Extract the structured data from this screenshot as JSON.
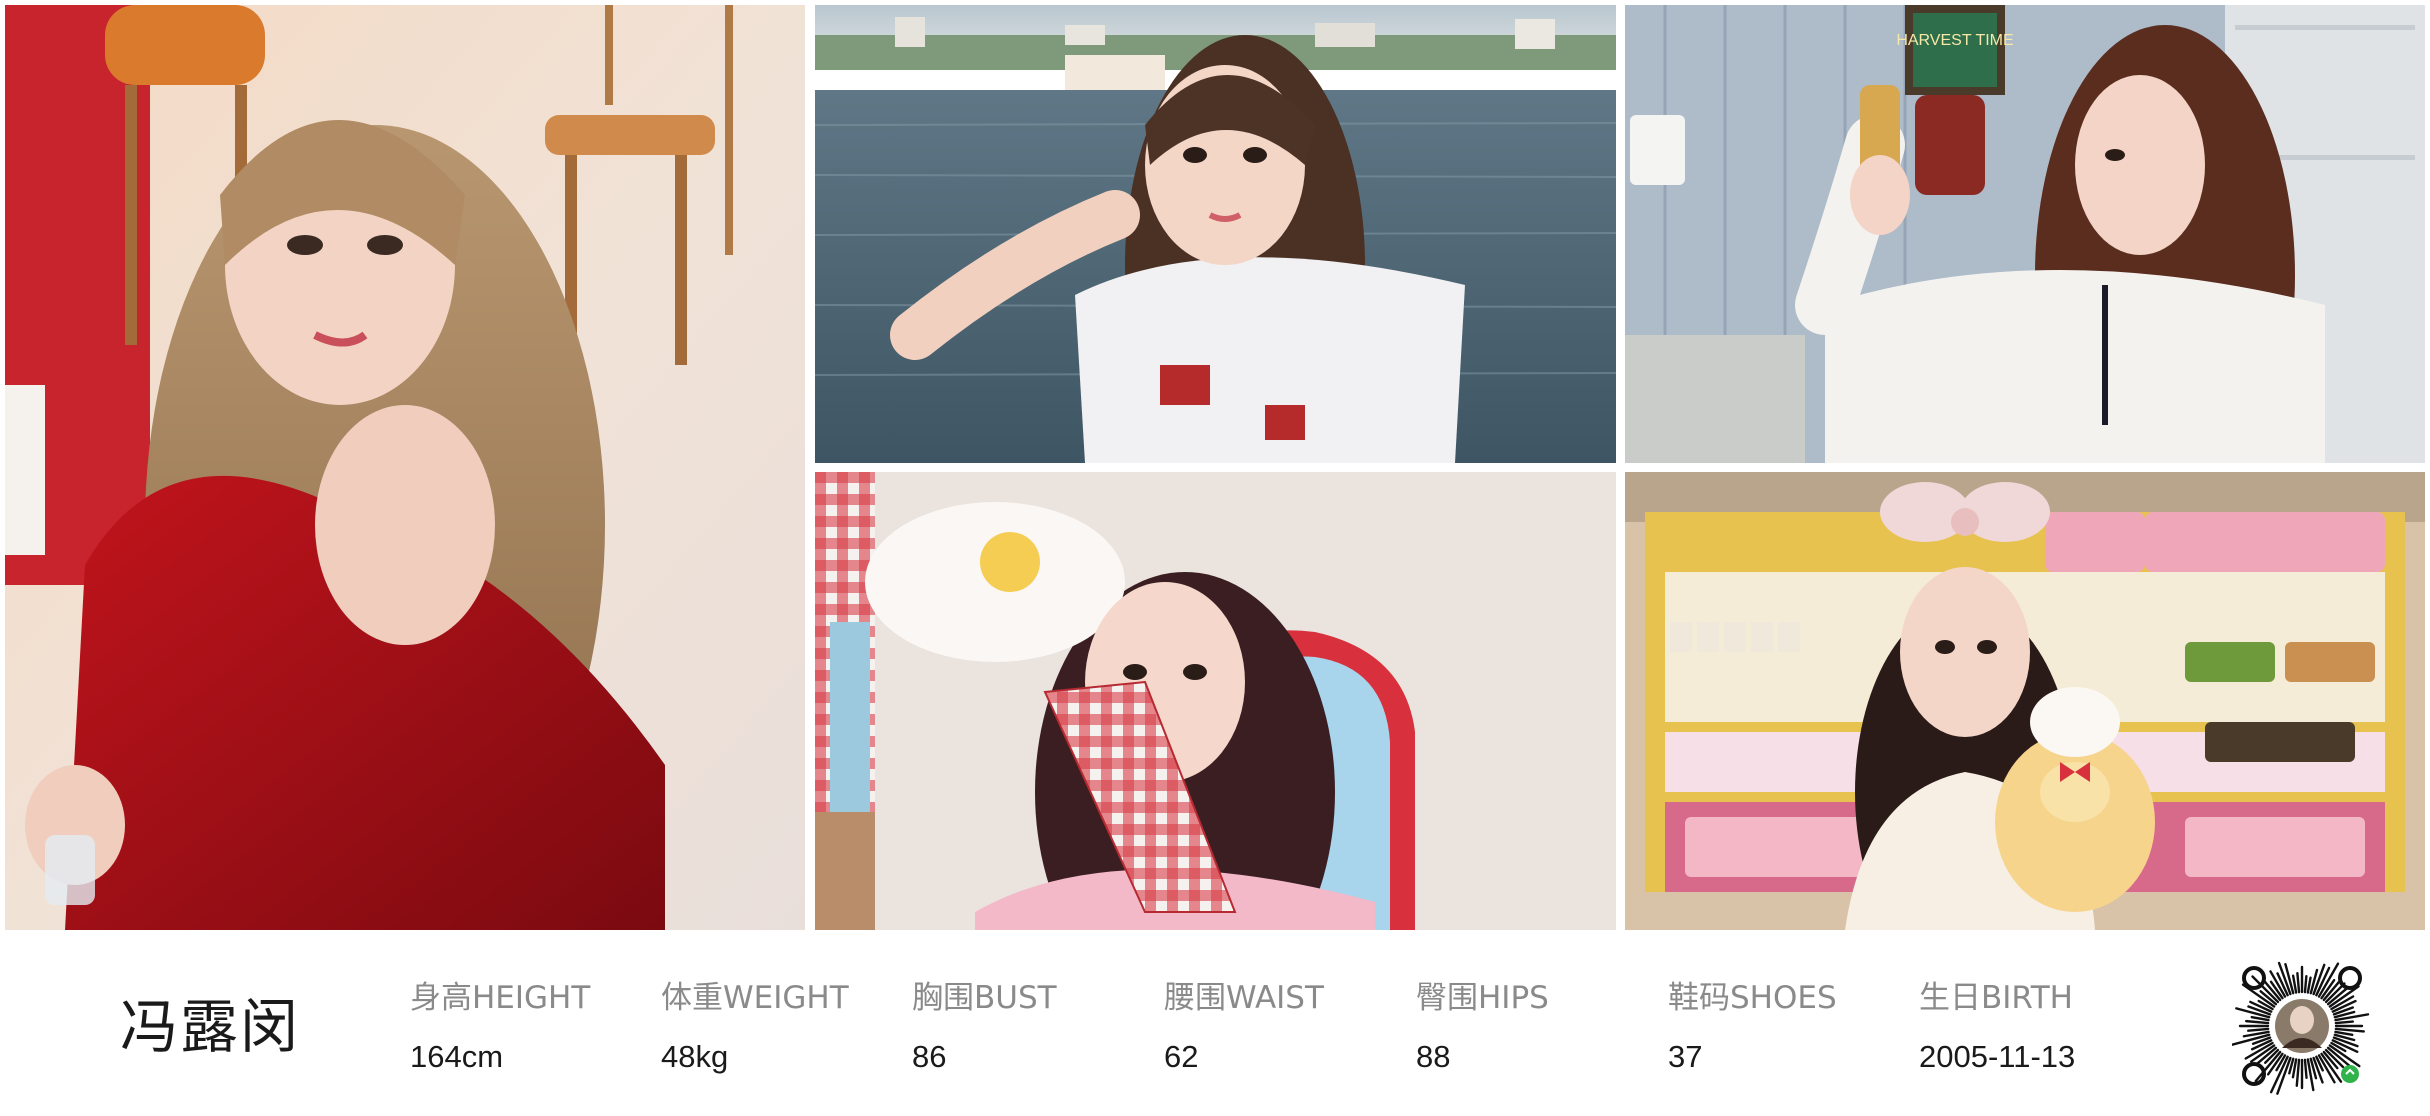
{
  "profile": {
    "name": "冯露闵"
  },
  "stats": [
    {
      "label": "身高HEIGHT",
      "value": "164cm"
    },
    {
      "label": "体重WEIGHT",
      "value": "48kg"
    },
    {
      "label": "胸围BUST",
      "value": "86"
    },
    {
      "label": "腰围WAIST",
      "value": "62"
    },
    {
      "label": "臀围HIPS",
      "value": "88"
    },
    {
      "label": "鞋码SHOES",
      "value": "37"
    },
    {
      "label": "生日BIRTH",
      "value": "2005-11-13"
    }
  ],
  "photos": {
    "photo_3_sign_text": "HARVEST TIME"
  },
  "colors": {
    "label_gray": "#8a8a8a",
    "value_black": "#1a1a1a",
    "background": "#ffffff"
  },
  "icons": {
    "qr": "wechat-mini-program-code"
  }
}
